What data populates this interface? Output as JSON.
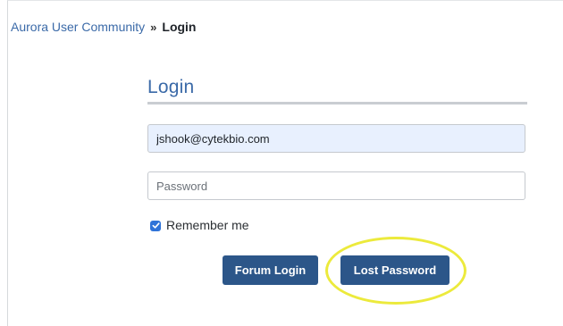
{
  "breadcrumb": {
    "community": "Aurora User Community",
    "separator": "»",
    "current": "Login"
  },
  "login": {
    "title": "Login",
    "email_value": "jshook@cytekbio.com",
    "password_placeholder": "Password",
    "remember_label": "Remember me",
    "remember_checked": true,
    "forum_login_label": "Forum Login",
    "lost_password_label": "Lost Password"
  },
  "colors": {
    "link": "#3b6aa8",
    "button_bg": "#2c5689",
    "checkbox": "#2f73d8",
    "highlight": "#ecea3c",
    "autofill_bg": "#e8f0fe"
  },
  "icons": {
    "checkbox": "checkmark-icon"
  }
}
